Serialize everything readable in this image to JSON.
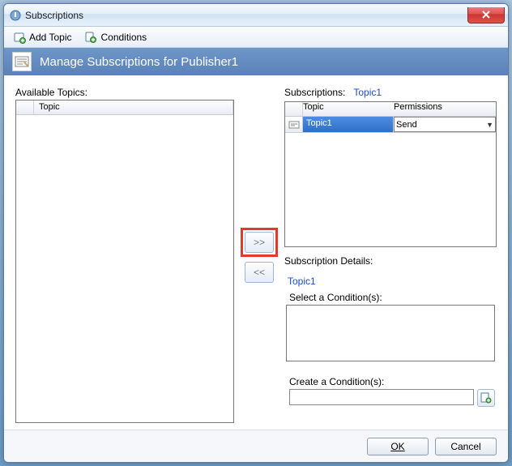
{
  "window": {
    "title": "Subscriptions"
  },
  "toolbar": {
    "add_topic": "Add Topic",
    "conditions": "Conditions"
  },
  "banner": {
    "text": "Manage Subscriptions for Publisher1"
  },
  "available": {
    "label": "Available Topics:",
    "columns": {
      "topic": "Topic"
    }
  },
  "subscriptions": {
    "label": "Subscriptions:",
    "current": "Topic1",
    "columns": {
      "topic": "Topic",
      "permissions": "Permissions"
    },
    "rows": [
      {
        "topic": "Topic1",
        "permission": "Send"
      }
    ]
  },
  "details": {
    "label": "Subscription Details:",
    "topic": "Topic1",
    "select_cond_label": "Select a Condition(s):",
    "create_cond_label": "Create a Condition(s):",
    "create_value": ""
  },
  "buttons": {
    "move_right": ">>",
    "move_left": "<<",
    "ok": "OK",
    "cancel": "Cancel"
  }
}
